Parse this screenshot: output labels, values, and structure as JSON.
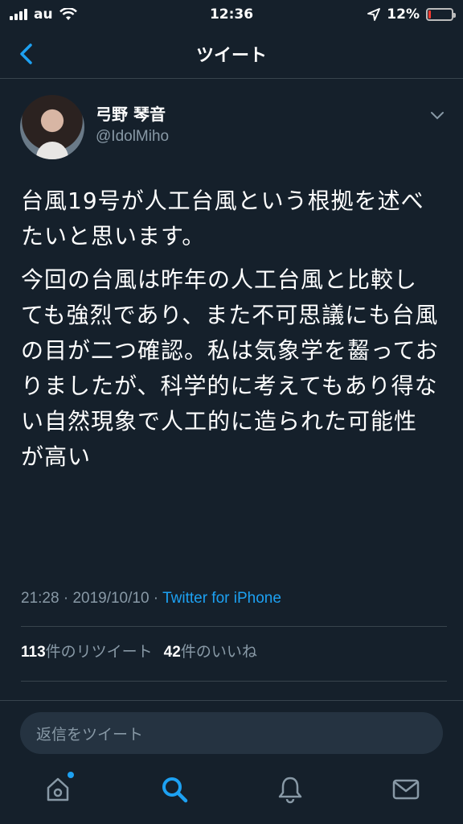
{
  "status_bar": {
    "carrier": "au",
    "time": "12:36",
    "battery_percent": "12%",
    "battery_level": 0.12
  },
  "nav": {
    "title": "ツイート",
    "back_icon": "chevron-left-icon"
  },
  "tweet": {
    "author": {
      "display_name": "弓野 琴音",
      "handle": "@IdolMiho"
    },
    "paragraphs": [
      "台風19号が人工台風という根拠を述べたいと思います。",
      "今回の台風は昨年の人工台風と比較しても強烈であり、また不可思議にも台風の目が二つ確認。私は気象学を齧っておりましたが、科学的に考えてもあり得ない自然現象で人工的に造られた可能性が高い"
    ],
    "time": "21:28",
    "date": "2019/10/10",
    "separator": " · ",
    "source": "Twitter for iPhone",
    "retweet_count": "113",
    "retweet_label": "件のリツイート",
    "like_count": "42",
    "like_label": "件のいいね"
  },
  "reply": {
    "placeholder": "返信をツイート"
  },
  "tab_bar": {
    "items": [
      "home-icon",
      "search-icon",
      "notifications-icon",
      "messages-icon"
    ]
  },
  "colors": {
    "background": "#15202b",
    "accent": "#1da1f2",
    "secondary_text": "#8899a6",
    "divider": "#38444d"
  }
}
